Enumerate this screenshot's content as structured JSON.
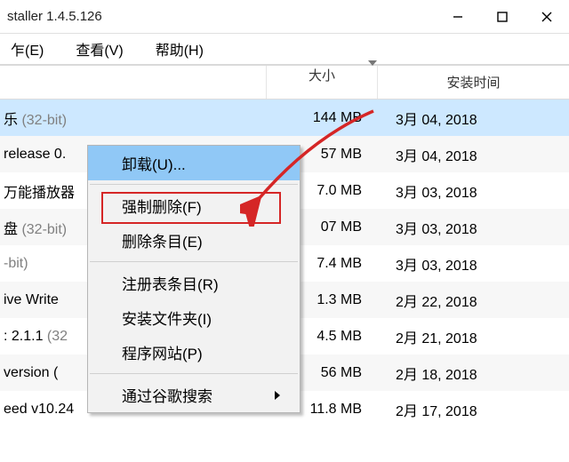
{
  "window": {
    "title": "staller 1.4.5.126"
  },
  "menubar": {
    "items": [
      "乍(E)",
      "查看(V)",
      "帮助(H)"
    ]
  },
  "columns": {
    "size": "大小",
    "date": "安装时间"
  },
  "rows": [
    {
      "name_a": "乐 ",
      "name_b": "(32-bit)",
      "size": "144 MB",
      "date": "3月 04, 2018",
      "selected": true
    },
    {
      "name_a": "release 0.",
      "name_b": "",
      "size": "57 MB",
      "date": "3月 04, 2018"
    },
    {
      "name_a": "万能播放器",
      "name_b": "",
      "size": "7.0 MB",
      "date": "3月 03, 2018"
    },
    {
      "name_a": "盘 ",
      "name_b": "(32-bit)",
      "size": "07 MB",
      "date": "3月 03, 2018"
    },
    {
      "name_a": "",
      "name_b": "-bit)",
      "size": "7.4 MB",
      "date": "3月 03, 2018"
    },
    {
      "name_a": "ive Write",
      "name_b": "",
      "size": "1.3 MB",
      "date": "2月 22, 2018"
    },
    {
      "name_a": ": 2.1.1 ",
      "name_b": "(32",
      "size": "4.5 MB",
      "date": "2月 21, 2018"
    },
    {
      "name_a": " version (",
      "name_b": "",
      "size": "56 MB",
      "date": "2月 18, 2018"
    },
    {
      "name_a": "eed v10.24",
      "name_b": "",
      "size": "11.8 MB",
      "date": "2月 17, 2018"
    }
  ],
  "context_menu": {
    "uninstall": "卸载(U)...",
    "force_delete": "强制删除(F)",
    "delete_entry": "删除条目(E)",
    "registry": "注册表条目(R)",
    "install_folder": "安装文件夹(I)",
    "website": "程序网站(P)",
    "google_search": "通过谷歌搜索"
  }
}
